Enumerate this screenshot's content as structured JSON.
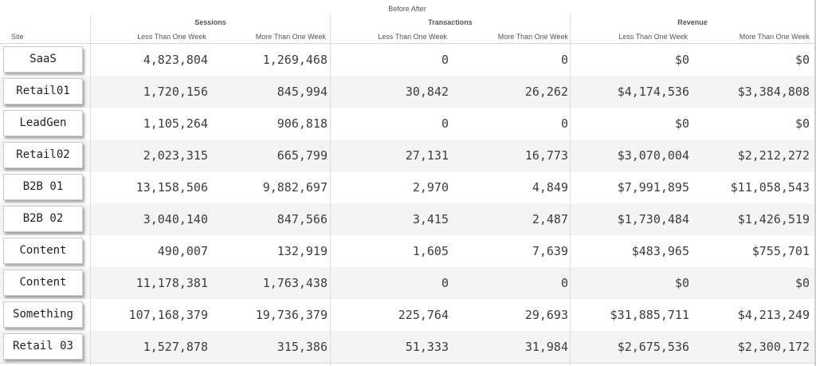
{
  "header": {
    "top_title": "Before After",
    "site_label": "Site",
    "groups": [
      "Sessions",
      "Transactions",
      "Revenue"
    ],
    "subheaders": [
      "Less Than One Week",
      "More Than One Week",
      "Less Than One Week",
      "More Than One Week",
      "Less Than One Week",
      "More Than One Week"
    ]
  },
  "rows": [
    {
      "site": "SaaS",
      "values": [
        "4,823,804",
        "1,269,468",
        "0",
        "0",
        "$0",
        "$0"
      ]
    },
    {
      "site": "Retail01",
      "values": [
        "1,720,156",
        "845,994",
        "30,842",
        "26,262",
        "$4,174,536",
        "$3,384,808"
      ]
    },
    {
      "site": "LeadGen",
      "values": [
        "1,105,264",
        "906,818",
        "0",
        "0",
        "$0",
        "$0"
      ]
    },
    {
      "site": "Retail02",
      "values": [
        "2,023,315",
        "665,799",
        "27,131",
        "16,773",
        "$3,070,004",
        "$2,212,272"
      ]
    },
    {
      "site": "B2B 01",
      "values": [
        "13,158,506",
        "9,882,697",
        "2,970",
        "4,849",
        "$7,991,895",
        "$11,058,543"
      ]
    },
    {
      "site": "B2B 02",
      "values": [
        "3,040,140",
        "847,566",
        "3,415",
        "2,487",
        "$1,730,484",
        "$1,426,519"
      ]
    },
    {
      "site": "Content",
      "values": [
        "490,007",
        "132,919",
        "1,605",
        "7,639",
        "$483,965",
        "$755,701"
      ]
    },
    {
      "site": "Content",
      "values": [
        "11,178,381",
        "1,763,438",
        "0",
        "0",
        "$0",
        "$0"
      ]
    },
    {
      "site": "Something",
      "values": [
        "107,168,379",
        "19,736,379",
        "225,764",
        "29,693",
        "$31,885,711",
        "$4,213,249"
      ]
    },
    {
      "site": "Retail 03",
      "values": [
        "1,527,878",
        "315,386",
        "51,333",
        "31,984",
        "$2,675,536",
        "$2,300,172"
      ]
    }
  ]
}
